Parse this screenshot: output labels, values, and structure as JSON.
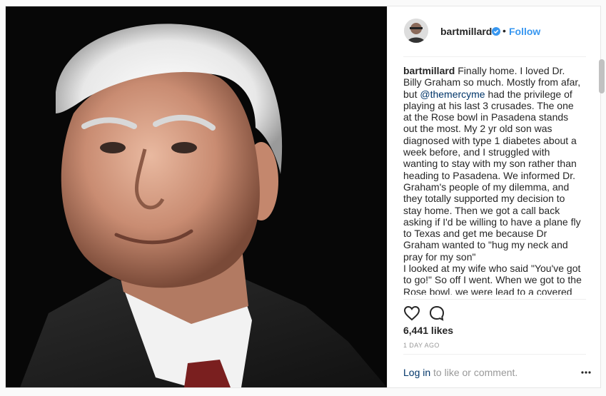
{
  "header": {
    "username": "bartmillard",
    "separator": "•",
    "follow_label": "Follow"
  },
  "caption": {
    "username": "bartmillard",
    "text_before_mention": "Finally home. I loved Dr. Billy Graham so much. Mostly from afar, but ",
    "mention": "@themercyme",
    "text_after_mention": " had the privilege of playing at his last 3 crusades. The one at the Rose bowl in Pasadena stands out the most. My 2 yr old son was diagnosed with type 1 diabetes about a week before, and I struggled with wanting to stay with my son rather than heading to Pasadena. We informed Dr. Graham's people of my dilemma, and they totally supported my decision to stay home. Then we got a call back asking if I'd be willing to have a plane fly to Texas and get me because Dr Graham wanted to \"hug my neck and pray for my son\"",
    "text_second_paragraph": "I looked at my wife who said \"You've got to go!\" So off I went. When we got to the Rose bowl, we were lead to a covered tent on one side of the stage and, like the"
  },
  "stats": {
    "likes": "6,441 likes",
    "time_ago": "1 DAY AGO"
  },
  "footer": {
    "login_link": "Log in",
    "login_text": " to like or comment."
  },
  "colors": {
    "link_blue": "#3897f0",
    "mention_blue": "#003569",
    "text": "#262626",
    "muted": "#999999"
  },
  "icons": [
    "verified-badge-icon",
    "heart-icon",
    "comment-icon",
    "more-options-icon"
  ]
}
